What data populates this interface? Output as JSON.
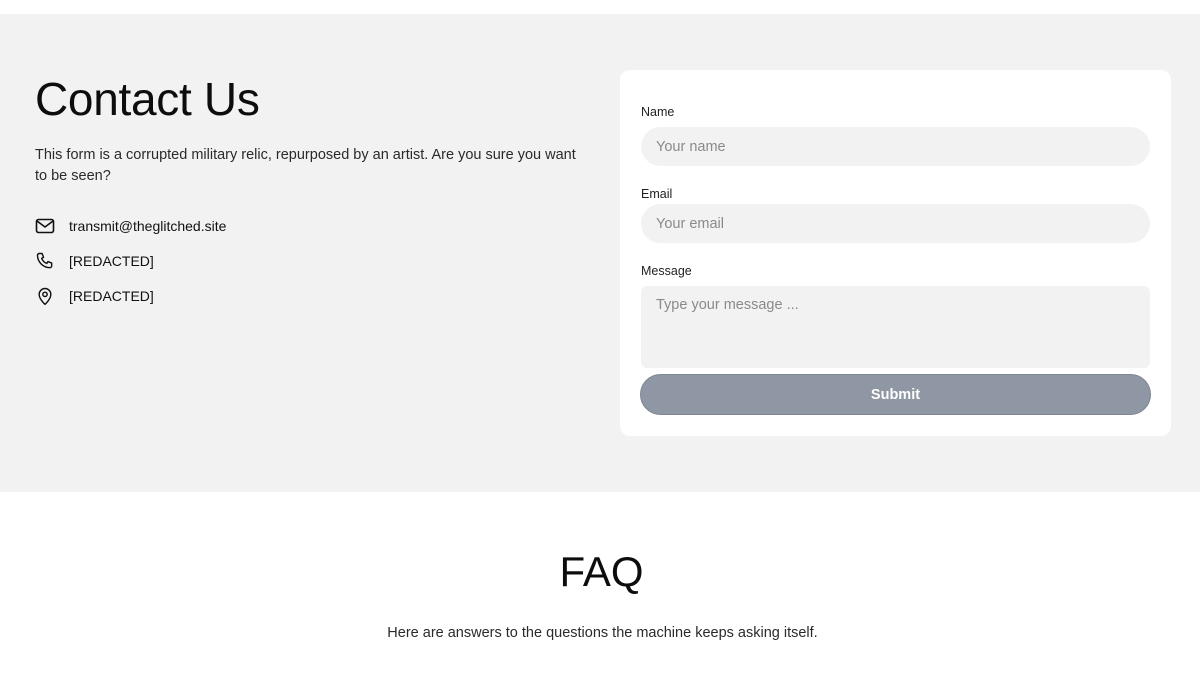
{
  "contact": {
    "title": "Contact Us",
    "description": "This form is a corrupted military relic, repurposed by an artist. Are you sure you want to be seen?",
    "info": [
      {
        "icon": "mail-icon",
        "text": "transmit@theglitched.site"
      },
      {
        "icon": "phone-icon",
        "text": "[REDACTED]"
      },
      {
        "icon": "location-pin-icon",
        "text": "[REDACTED]"
      }
    ]
  },
  "form": {
    "name_label": "Name",
    "name_placeholder": "Your name",
    "name_value": "",
    "email_label": "Email",
    "email_placeholder": "Your email",
    "email_value": "",
    "message_label": "Message",
    "message_placeholder": "Type your message ...",
    "message_value": "",
    "submit_label": "Submit"
  },
  "faq": {
    "title": "FAQ",
    "subtitle": "Here are answers to the questions the machine keeps asking itself."
  },
  "colors": {
    "section_bg": "#f2f2f2",
    "submit_bg": "#8e97a3"
  }
}
